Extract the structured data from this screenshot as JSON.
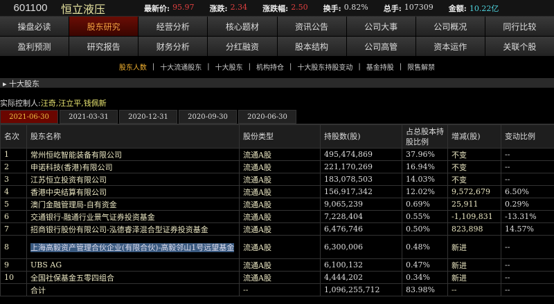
{
  "header": {
    "code": "601100",
    "name": "恒立液压",
    "quotes": [
      {
        "label": "最新价:",
        "value": "95.97",
        "color": "red"
      },
      {
        "label": "涨跌:",
        "value": "2.34",
        "color": "red"
      },
      {
        "label": "涨跌幅:",
        "value": "2.50",
        "color": "red"
      },
      {
        "label": "换手:",
        "value": "0.82%",
        "color": ""
      },
      {
        "label": "总手:",
        "value": "107309",
        "color": ""
      },
      {
        "label": "金额:",
        "value": "10.22亿",
        "color": "cyan"
      }
    ]
  },
  "nav": [
    "操盘必读",
    "股东研究",
    "经营分析",
    "核心题材",
    "资讯公告",
    "公司大事",
    "公司概况",
    "同行比较",
    "盈利预测",
    "研究报告",
    "财务分析",
    "分红融资",
    "股本结构",
    "公司高管",
    "资本运作",
    "关联个股"
  ],
  "nav_active": "股东研究",
  "subnav": [
    "股东人数",
    "十大流通股东",
    "十大股东",
    "机构持仓",
    "十大股东持股变动",
    "基金持股",
    "限售解禁"
  ],
  "subnav_active": "股东人数",
  "section_title": "十大股东",
  "controller": {
    "label": "实际控制人:",
    "value": "汪奇,汪立平,钱佩新"
  },
  "date_tabs": [
    "2021-06-30",
    "2021-03-31",
    "2020-12-31",
    "2020-09-30",
    "2020-06-30"
  ],
  "date_active": "2021-06-30",
  "table": {
    "headers": [
      "名次",
      "股东名称",
      "股份类型",
      "持股数(股)",
      "占总股本持股比例",
      "增减(股)",
      "变动比例"
    ],
    "rows": [
      [
        "1",
        "常州恒屹智能装备有限公司",
        "流通A股",
        "495,474,869",
        "37.96%",
        "不变",
        "--"
      ],
      [
        "2",
        "申诺科技(香港)有限公司",
        "流通A股",
        "221,170,269",
        "16.94%",
        "不变",
        "--"
      ],
      [
        "3",
        "江苏恒立投资有限公司",
        "流通A股",
        "183,078,503",
        "14.03%",
        "不变",
        "--"
      ],
      [
        "4",
        "香港中央结算有限公司",
        "流通A股",
        "156,917,342",
        "12.02%",
        "9,572,679",
        "6.50%"
      ],
      [
        "5",
        "澳门金融管理局-自有资金",
        "流通A股",
        "9,065,239",
        "0.69%",
        "25,911",
        "0.29%"
      ],
      [
        "6",
        "交通银行-融通行业景气证券投资基金",
        "流通A股",
        "7,228,404",
        "0.55%",
        "-1,109,831",
        "-13.31%"
      ],
      [
        "7",
        "招商银行股份有限公司-泓德睿泽混合型证券投资基金",
        "流通A股",
        "6,476,746",
        "0.50%",
        "823,898",
        "14.57%"
      ],
      [
        "8",
        "上海高毅资产管理合伙企业(有限合伙)-高毅邻山1号远望基金",
        "流通A股",
        "6,300,006",
        "0.48%",
        "新进",
        "--"
      ],
      [
        "9",
        "UBS AG",
        "流通A股",
        "6,100,132",
        "0.47%",
        "新进",
        "--"
      ],
      [
        "10",
        "全国社保基金五零四组合",
        "流通A股",
        "4,444,202",
        "0.34%",
        "新进",
        "--"
      ],
      [
        "",
        "合计",
        "--",
        "1,096,255,712",
        "83.98%",
        "--",
        "--"
      ]
    ]
  },
  "colors": {
    "active_tab": "#6a0600",
    "accent": "#f0b030",
    "red": "#e04040",
    "cyan": "#4fd6e0"
  }
}
